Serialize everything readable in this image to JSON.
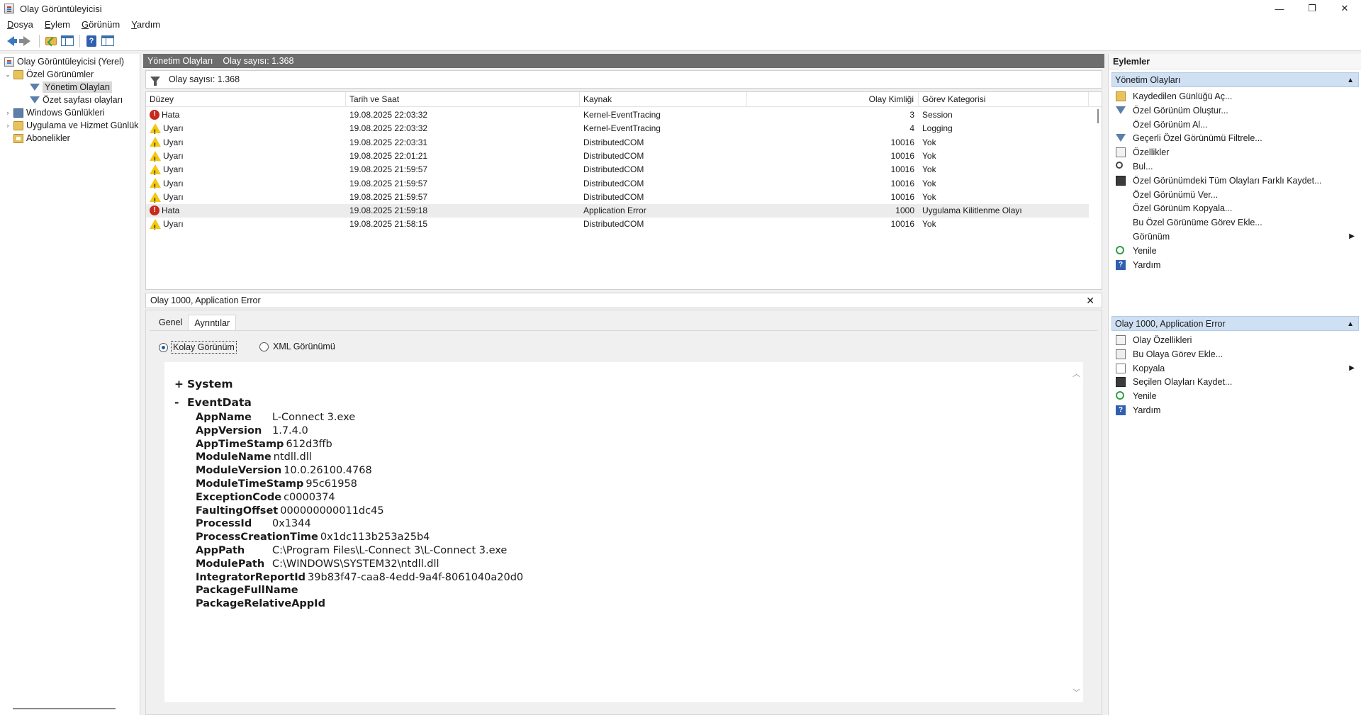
{
  "window": {
    "title": "Olay Görüntüleyicisi",
    "minimize": "—",
    "restore": "❐",
    "close": "✕"
  },
  "menu": [
    {
      "label": "Dosya",
      "accel": "D",
      "rest": "osya"
    },
    {
      "label": "Eylem",
      "accel": "E",
      "rest": "ylem"
    },
    {
      "label": "Görünüm",
      "accel": "G",
      "rest": "örünüm"
    },
    {
      "label": "Yardım",
      "accel": "Y",
      "rest": "ardım"
    }
  ],
  "tree": {
    "root": "Olay Görüntüleyicisi (Yerel)",
    "custom_views": "Özel Görünümler",
    "admin_events": "Yönetim Olayları",
    "summary_events": "Özet sayfası olayları",
    "windows_logs": "Windows Günlükleri",
    "app_service_logs": "Uygulama ve Hizmet Günlük",
    "subscriptions": "Abonelikler"
  },
  "list": {
    "title": "Yönetim Olayları",
    "count_label": "Olay sayısı: 1.368",
    "filter_text": "Olay sayısı: 1.368",
    "columns": {
      "level": "Düzey",
      "datetime": "Tarih ve Saat",
      "source": "Kaynak",
      "event_id": "Olay Kimliği",
      "task": "Görev Kategorisi"
    },
    "rows": [
      {
        "level": "Hata",
        "type": "error",
        "datetime": "19.08.2025 22:03:32",
        "source": "Kernel-EventTracing",
        "event_id": "3",
        "task": "Session"
      },
      {
        "level": "Uyarı",
        "type": "warning",
        "datetime": "19.08.2025 22:03:32",
        "source": "Kernel-EventTracing",
        "event_id": "4",
        "task": "Logging"
      },
      {
        "level": "Uyarı",
        "type": "warning",
        "datetime": "19.08.2025 22:03:31",
        "source": "DistributedCOM",
        "event_id": "10016",
        "task": "Yok"
      },
      {
        "level": "Uyarı",
        "type": "warning",
        "datetime": "19.08.2025 22:01:21",
        "source": "DistributedCOM",
        "event_id": "10016",
        "task": "Yok"
      },
      {
        "level": "Uyarı",
        "type": "warning",
        "datetime": "19.08.2025 21:59:57",
        "source": "DistributedCOM",
        "event_id": "10016",
        "task": "Yok"
      },
      {
        "level": "Uyarı",
        "type": "warning",
        "datetime": "19.08.2025 21:59:57",
        "source": "DistributedCOM",
        "event_id": "10016",
        "task": "Yok"
      },
      {
        "level": "Uyarı",
        "type": "warning",
        "datetime": "19.08.2025 21:59:57",
        "source": "DistributedCOM",
        "event_id": "10016",
        "task": "Yok"
      },
      {
        "level": "Hata",
        "type": "error",
        "datetime": "19.08.2025 21:59:18",
        "source": "Application Error",
        "event_id": "1000",
        "task": "Uygulama Kilitlenme Olayı",
        "selected": true
      },
      {
        "level": "Uyarı",
        "type": "warning",
        "datetime": "19.08.2025 21:58:15",
        "source": "DistributedCOM",
        "event_id": "10016",
        "task": "Yok"
      }
    ]
  },
  "detail": {
    "header": "Olay 1000, Application Error",
    "close": "✕",
    "tabs": [
      "Genel",
      "Ayrıntılar"
    ],
    "active_tab": "Ayrıntılar",
    "friendly_view": "Kolay Görünüm",
    "xml_view": "XML Görünümü",
    "system_section": "System",
    "system_toggle": "+",
    "eventdata_section": "EventData",
    "eventdata_toggle": "-",
    "fields": [
      {
        "key": "AppName",
        "value": "L-Connect 3.exe"
      },
      {
        "key": "AppVersion",
        "value": "1.7.4.0"
      },
      {
        "key": "AppTimeStamp",
        "value": "612d3ffb"
      },
      {
        "key": "ModuleName",
        "value": "ntdll.dll"
      },
      {
        "key": "ModuleVersion",
        "value": "10.0.26100.4768"
      },
      {
        "key": "ModuleTimeStamp",
        "value": "95c61958"
      },
      {
        "key": "ExceptionCode",
        "value": "c0000374"
      },
      {
        "key": "FaultingOffset",
        "value": "000000000011dc45"
      },
      {
        "key": "ProcessId",
        "value": "0x1344"
      },
      {
        "key": "ProcessCreationTime",
        "value": "0x1dc113b253a25b4"
      },
      {
        "key": "AppPath",
        "value": "C:\\Program Files\\L-Connect 3\\L-Connect 3.exe"
      },
      {
        "key": "ModulePath",
        "value": "C:\\WINDOWS\\SYSTEM32\\ntdll.dll"
      },
      {
        "key": "IntegratorReportId",
        "value": "39b83f47-caa8-4edd-9a4f-8061040a20d0"
      },
      {
        "key": "PackageFullName",
        "value": ""
      },
      {
        "key": "PackageRelativeAppId",
        "value": ""
      }
    ]
  },
  "actions": {
    "title": "Eylemler",
    "section1": "Yönetim Olayları",
    "section1_items": [
      {
        "label": "Kaydedilen Günlüğü Aç...",
        "icon": "folder-open-icon"
      },
      {
        "label": "Özel Görünüm Oluştur...",
        "icon": "filter-icon"
      },
      {
        "label": "Özel Görünüm Al...",
        "icon": ""
      },
      {
        "label": "Geçerli Özel Görünümü Filtrele...",
        "icon": "filter-icon"
      },
      {
        "label": "Özellikler",
        "icon": "properties-icon"
      },
      {
        "label": "Bul...",
        "icon": "find-icon"
      },
      {
        "label": "Özel Görünümdeki Tüm Olayları Farklı Kaydet...",
        "icon": "save-icon"
      },
      {
        "label": "Özel Görünümü Ver...",
        "icon": ""
      },
      {
        "label": "Özel Görünüm Kopyala...",
        "icon": ""
      },
      {
        "label": "Bu Özel Görünüme Görev Ekle...",
        "icon": ""
      },
      {
        "label": "Görünüm",
        "icon": "",
        "submenu": true
      },
      {
        "label": "Yenile",
        "icon": "refresh-icon"
      },
      {
        "label": "Yardım",
        "icon": "help-icon"
      }
    ],
    "section2": "Olay 1000, Application Error",
    "section2_items": [
      {
        "label": "Olay Özellikleri",
        "icon": "properties-icon"
      },
      {
        "label": "Bu Olaya Görev Ekle...",
        "icon": "task-icon"
      },
      {
        "label": "Kopyala",
        "icon": "copy-icon",
        "submenu": true
      },
      {
        "label": "Seçilen Olayları Kaydet...",
        "icon": "save-icon"
      },
      {
        "label": "Yenile",
        "icon": "refresh-icon"
      },
      {
        "label": "Yardım",
        "icon": "help-icon"
      }
    ]
  }
}
